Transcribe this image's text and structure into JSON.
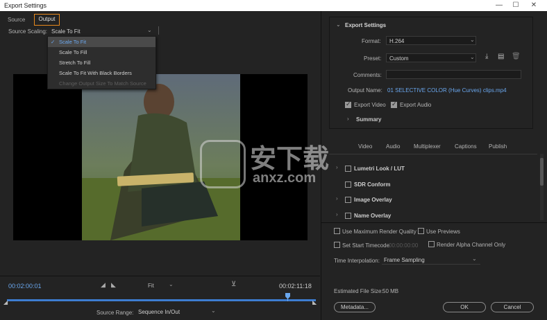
{
  "window": {
    "title": "Export Settings",
    "minimize": "—",
    "maximize": "☐",
    "close": "✕"
  },
  "tabs": {
    "source": "Source",
    "output": "Output"
  },
  "source_scaling": {
    "label": "Source Scaling:",
    "value": "Scale To Fit",
    "options": [
      {
        "label": "Scale To Fit",
        "selected": true,
        "disabled": false
      },
      {
        "label": "Scale To Fill",
        "selected": false,
        "disabled": false
      },
      {
        "label": "Stretch To Fill",
        "selected": false,
        "disabled": false
      },
      {
        "label": "Scale To Fit With Black Borders",
        "selected": false,
        "disabled": false
      },
      {
        "label": "Change Output Size To Match Source",
        "selected": false,
        "disabled": true
      }
    ]
  },
  "timeline": {
    "current_time": "00:02:00:01",
    "fit_value": "Fit",
    "end_time": "00:02:11:18",
    "playhead_fraction": 0.91,
    "source_range_label": "Source Range:",
    "source_range_value": "Sequence In/Out"
  },
  "export_settings": {
    "header": "Export Settings",
    "format_label": "Format:",
    "format_value": "H.264",
    "preset_label": "Preset:",
    "preset_value": "Custom",
    "comments_label": "Comments:",
    "comments_value": "",
    "output_name_label": "Output Name:",
    "output_name_value": "01 SELECTIVE COLOR (Hue Curves) clips.mp4",
    "export_video_label": "Export Video",
    "export_video_checked": true,
    "export_audio_label": "Export Audio",
    "export_audio_checked": true,
    "summary_label": "Summary"
  },
  "settings_tabs": [
    "Video",
    "Audio",
    "Multiplexer",
    "Captions",
    "Publish"
  ],
  "effects": [
    {
      "label": "Lumetri Look / LUT",
      "checked": false
    },
    {
      "label": "SDR Conform",
      "checked": false
    },
    {
      "label": "Image Overlay",
      "checked": false
    },
    {
      "label": "Name Overlay",
      "checked": false
    }
  ],
  "render_options": {
    "max_render_quality": "Use Maximum Render Quality",
    "use_previews": "Use Previews",
    "set_start_timecode": "Set Start Timecode",
    "start_timecode_value": "00:00:00:00",
    "render_alpha": "Render Alpha Channel Only",
    "time_interpolation_label": "Time Interpolation:",
    "time_interpolation_value": "Frame Sampling"
  },
  "estimated_file_size_label": "Estimated File Size:",
  "estimated_file_size_value": "50 MB",
  "buttons": {
    "metadata": "Metadata...",
    "ok": "OK",
    "cancel": "Cancel"
  },
  "watermark": {
    "text": "安下载",
    "subtext": "anxz.com"
  },
  "colors": {
    "accent_orange": "#e8891d",
    "accent_blue": "#6aa7ee",
    "background": "#232323"
  },
  "icons": {
    "import_preset": "import-preset-icon",
    "save_preset": "save-preset-icon",
    "delete_preset": "trash-icon"
  }
}
